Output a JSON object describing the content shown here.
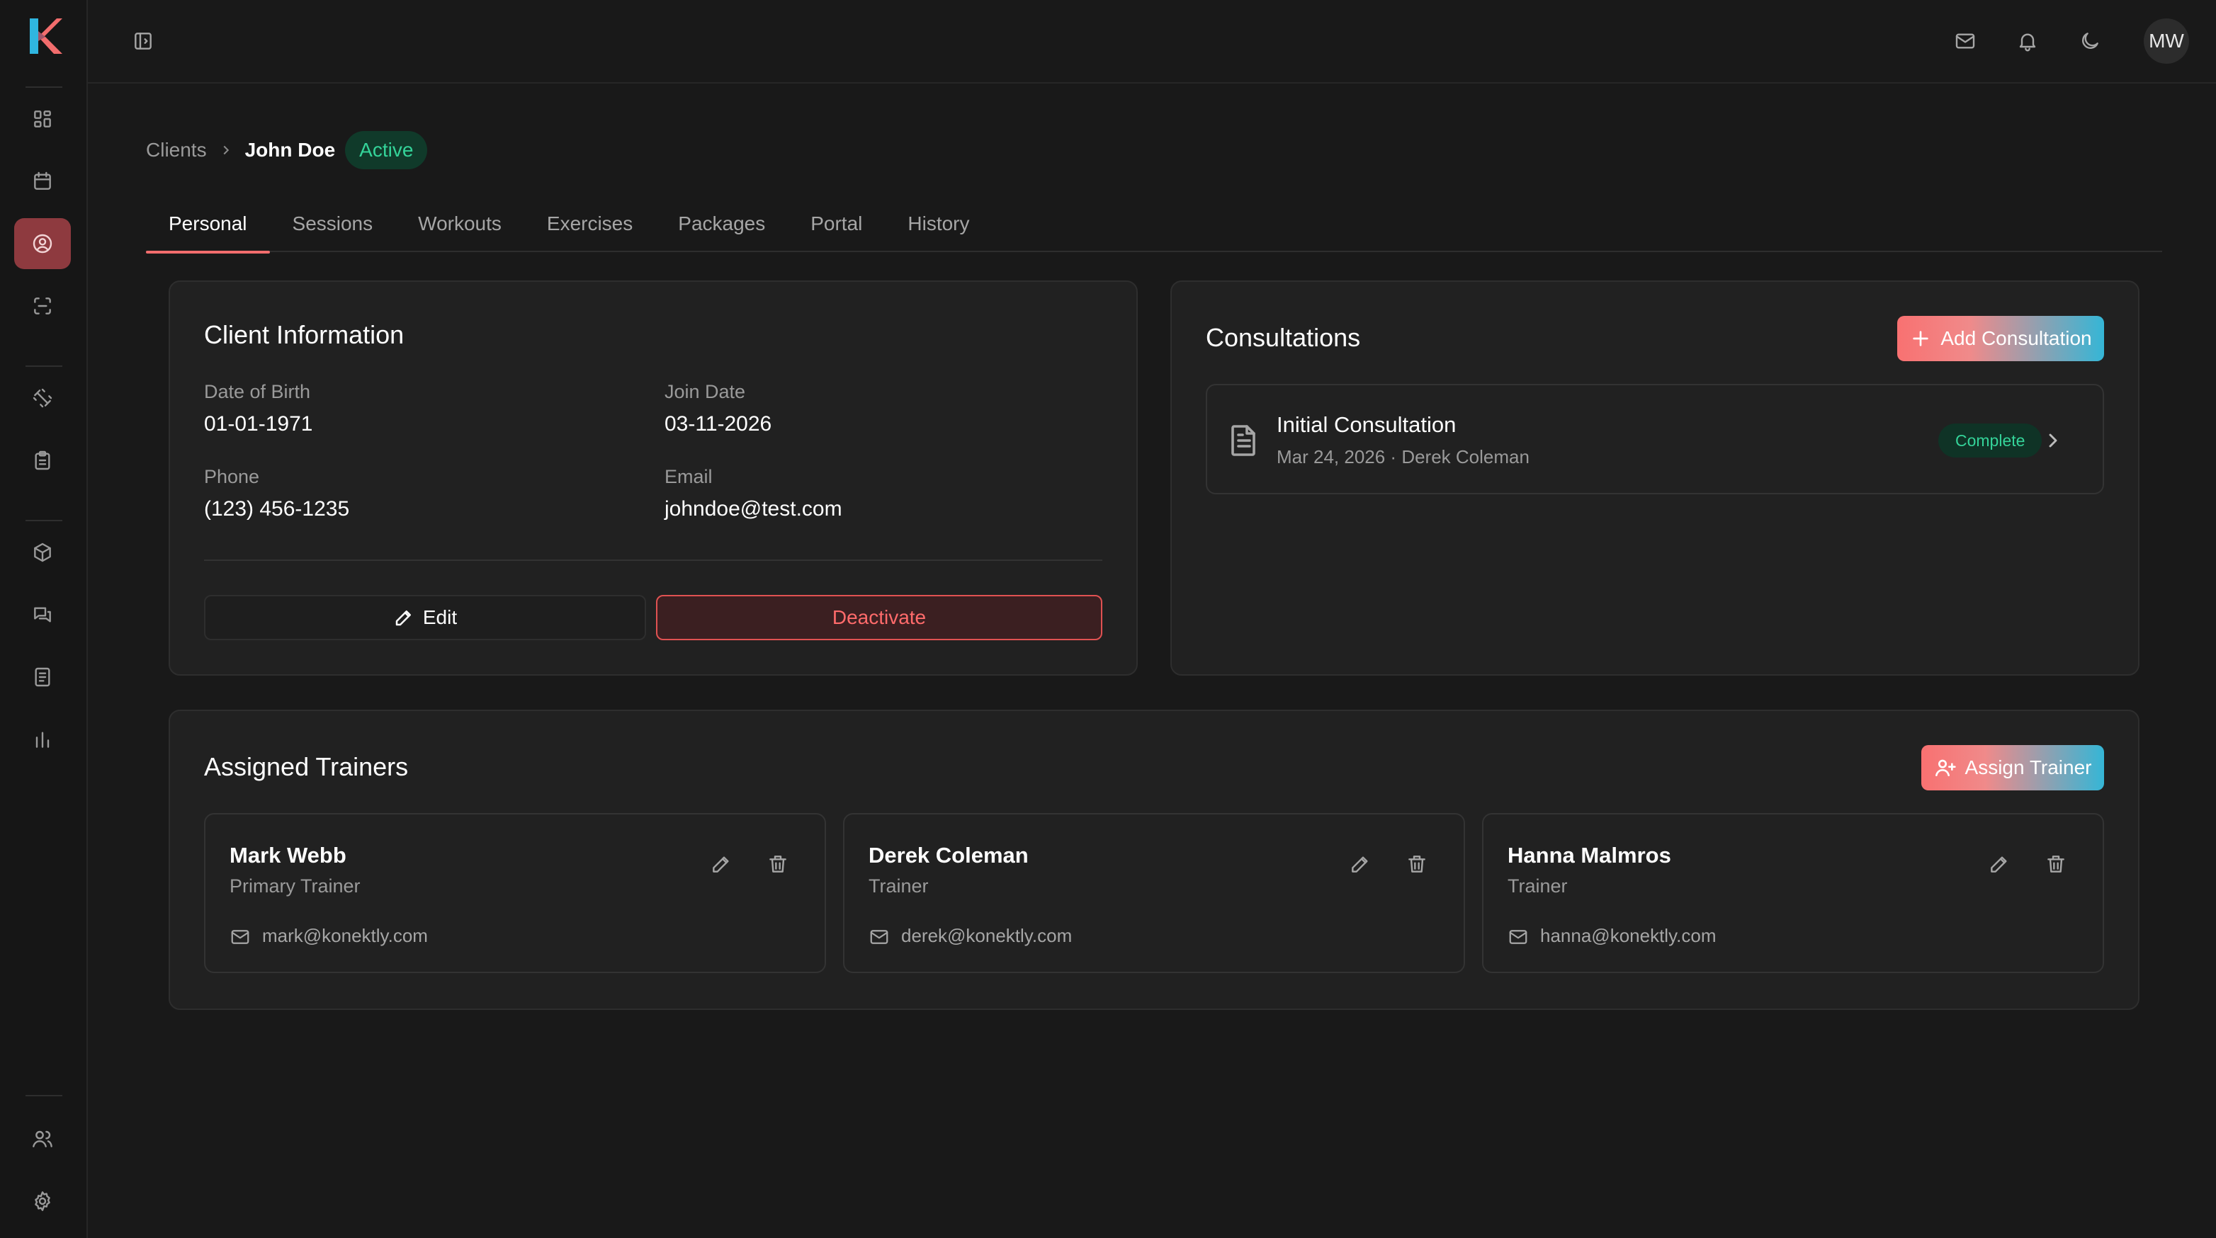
{
  "app": {
    "logo": "K",
    "user_initials": "MW"
  },
  "sidebar": {
    "items": [
      {
        "icon": "dashboard-icon",
        "active": false
      },
      {
        "icon": "calendar-icon",
        "active": false
      },
      {
        "icon": "user-circle-icon",
        "active": true
      },
      {
        "icon": "scan-icon",
        "active": false
      },
      {
        "icon": "dumbbell-icon",
        "active": false
      },
      {
        "icon": "clipboard-icon",
        "active": false
      },
      {
        "icon": "package-icon",
        "active": false
      },
      {
        "icon": "messages-icon",
        "active": false
      },
      {
        "icon": "document-icon",
        "active": false
      },
      {
        "icon": "bar-chart-icon",
        "active": false
      },
      {
        "icon": "users-icon",
        "active": false
      },
      {
        "icon": "settings-icon",
        "active": false
      }
    ]
  },
  "topbar": {
    "icons": [
      "sidebar-toggle-icon",
      "mail-icon",
      "bell-icon",
      "moon-icon"
    ]
  },
  "breadcrumb": {
    "parent": "Clients",
    "current": "John Doe",
    "status": "Active"
  },
  "tabs": [
    "Personal",
    "Sessions",
    "Workouts",
    "Exercises",
    "Packages",
    "Portal",
    "History"
  ],
  "client_info": {
    "title": "Client Information",
    "dob_label": "Date of Birth",
    "dob": "01-01-1971",
    "join_label": "Join Date",
    "join": "03-11-2026",
    "phone_label": "Phone",
    "phone": "(123) 456-1235",
    "email_label": "Email",
    "email": "johndoe@test.com",
    "edit_label": "Edit",
    "deactivate_label": "Deactivate"
  },
  "consultations": {
    "title": "Consultations",
    "add_label": "Add Consultation",
    "items": [
      {
        "title": "Initial Consultation",
        "subtitle": "Mar 24, 2026 · Derek Coleman",
        "status": "Complete"
      }
    ]
  },
  "trainers": {
    "title": "Assigned Trainers",
    "assign_label": "Assign Trainer",
    "items": [
      {
        "name": "Mark Webb",
        "role": "Primary Trainer",
        "email": "mark@konektly.com"
      },
      {
        "name": "Derek Coleman",
        "role": "Trainer",
        "email": "derek@konektly.com"
      },
      {
        "name": "Hanna Malmros",
        "role": "Trainer",
        "email": "hanna@konektly.com"
      }
    ]
  },
  "colors": {
    "accent": "#f26d6d",
    "success": "#34d399",
    "danger": "#e05252",
    "gradient_end": "#35b6d6"
  }
}
